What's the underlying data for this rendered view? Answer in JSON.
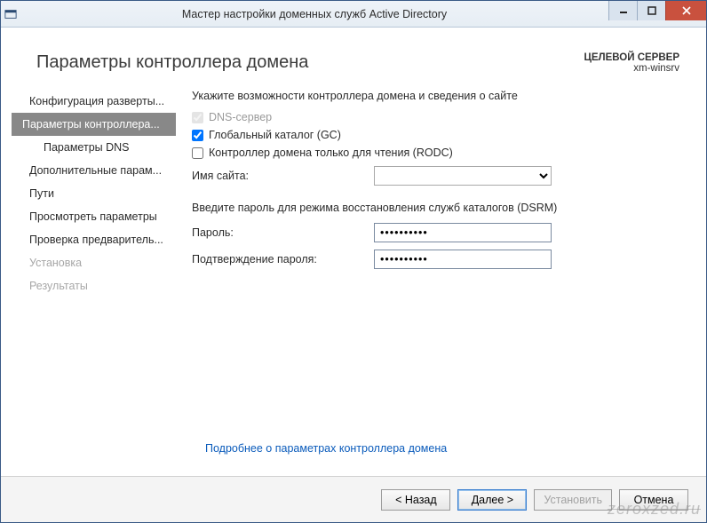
{
  "titlebar": {
    "title": "Мастер настройки доменных служб Active Directory"
  },
  "header": {
    "heading": "Параметры контроллера домена",
    "target_label": "ЦЕЛЕВОЙ СЕРВЕР",
    "target_value": "xm-winsrv"
  },
  "nav": {
    "items": [
      {
        "label": "Конфигурация разверты...",
        "state": "normal"
      },
      {
        "label": "Параметры контроллера...",
        "state": "selected"
      },
      {
        "label": "Параметры DNS",
        "state": "normal",
        "indent": true
      },
      {
        "label": "Дополнительные парам...",
        "state": "normal"
      },
      {
        "label": "Пути",
        "state": "normal"
      },
      {
        "label": "Просмотреть параметры",
        "state": "normal"
      },
      {
        "label": "Проверка предваритель...",
        "state": "normal"
      },
      {
        "label": "Установка",
        "state": "disabled"
      },
      {
        "label": "Результаты",
        "state": "disabled"
      }
    ]
  },
  "content": {
    "capabilities_instr": "Укажите возможности контроллера домена и сведения о сайте",
    "dns_label": "DNS-сервер",
    "dns_checked": true,
    "dns_disabled": true,
    "gc_label": "Глобальный каталог (GC)",
    "gc_checked": true,
    "rodc_label": "Контроллер домена только для чтения (RODC)",
    "rodc_checked": false,
    "site_label": "Имя сайта:",
    "site_value": "",
    "dsrm_instr": "Введите пароль для режима восстановления служб каталогов (DSRM)",
    "password_label": "Пароль:",
    "password_value": "••••••••••",
    "confirm_label": "Подтверждение пароля:",
    "confirm_value": "••••••••••",
    "learn_more": "Подробнее о параметрах контроллера домена"
  },
  "footer": {
    "back": "< Назад",
    "next": "Далее >",
    "install": "Установить",
    "cancel": "Отмена"
  },
  "watermark": "zeroxzed.ru"
}
